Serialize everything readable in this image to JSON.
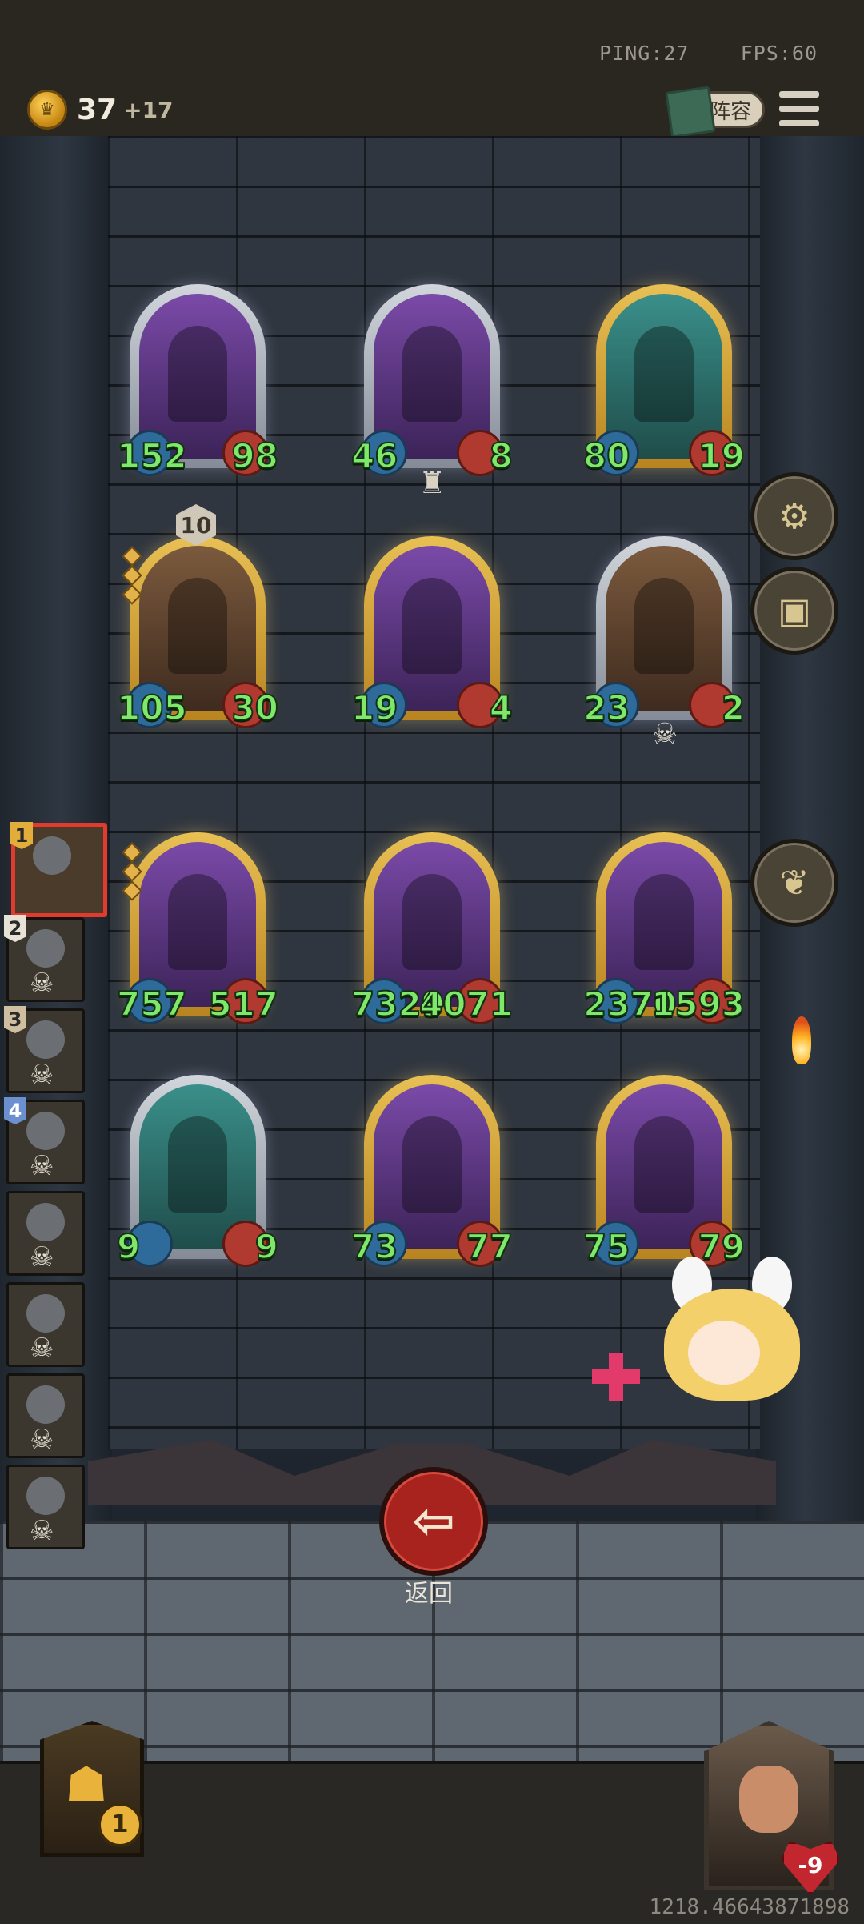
{
  "hud": {
    "ping_label": "PING:27",
    "fps_label": "FPS:60",
    "gold": "37",
    "gold_income": "+17",
    "lineup_label": "阵容",
    "coordinates": "1218.46643871898"
  },
  "board": [
    {
      "atk": "152",
      "hp": "98"
    },
    {
      "atk": "46",
      "hp": "8"
    },
    {
      "atk": "80",
      "hp": "19"
    },
    {
      "atk": "105",
      "hp": "30",
      "level": "10"
    },
    {
      "atk": "19",
      "hp": "4"
    },
    {
      "atk": "23",
      "hp": "2"
    },
    {
      "atk": "757",
      "hp": "517"
    },
    {
      "atk": "7329",
      "hp": "4071"
    },
    {
      "atk": "2370",
      "hp": "1593"
    },
    {
      "atk": "9",
      "hp": "9"
    },
    {
      "atk": "73",
      "hp": "77"
    },
    {
      "atk": "75",
      "hp": "79"
    }
  ],
  "queue": [
    {
      "num": "1"
    },
    {
      "num": "2"
    },
    {
      "num": "3"
    },
    {
      "num": "4"
    }
  ],
  "controls": {
    "back_label": "返回",
    "back_icon": "arrow-left-icon"
  },
  "player": {
    "hero_count": "1"
  },
  "enemy": {
    "health": "-9"
  }
}
